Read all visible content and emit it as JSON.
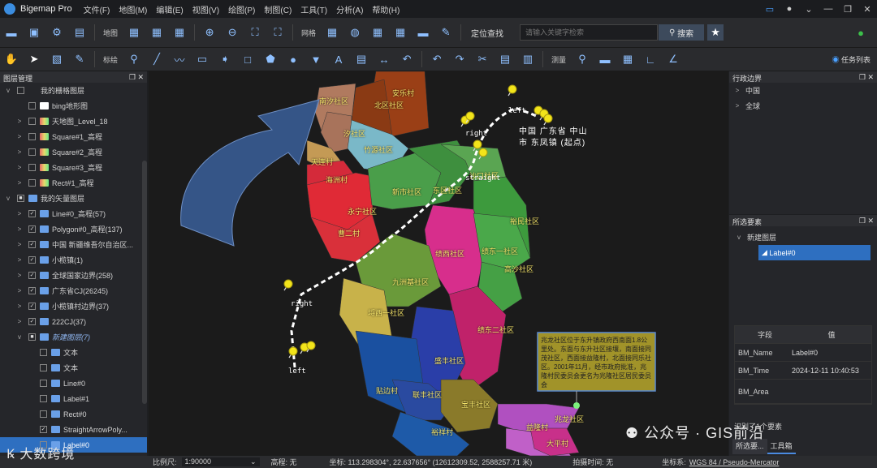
{
  "app": {
    "title": "Bigemap Pro"
  },
  "menu": [
    "文件(F)",
    "地图(M)",
    "编辑(E)",
    "视图(V)",
    "绘图(P)",
    "制图(C)",
    "工具(T)",
    "分析(A)",
    "帮助(H)"
  ],
  "toolbar1": {
    "map_label": "地图",
    "grid_label": "网格",
    "locate_label": "定位查找",
    "search_placeholder": "请输入关键字检索",
    "search_button": "搜索"
  },
  "toolbar2": {
    "annotate_label": "标绘",
    "measure_label": "测量",
    "task_list": "任务列表"
  },
  "layer_panel": {
    "title": "图层管理",
    "items": [
      {
        "level": 0,
        "label": "我的栅格图层",
        "expand": "v",
        "check": ""
      },
      {
        "level": 1,
        "label": "bing地形图",
        "expand": "",
        "check": ""
      },
      {
        "level": 1,
        "label": "天地图_Level_18",
        "expand": ">",
        "check": ""
      },
      {
        "level": 1,
        "label": "Square#1_高程",
        "expand": ">",
        "check": ""
      },
      {
        "level": 1,
        "label": "Square#2_高程",
        "expand": ">",
        "check": ""
      },
      {
        "level": 1,
        "label": "Square#3_高程",
        "expand": ">",
        "check": ""
      },
      {
        "level": 1,
        "label": "Rect#1_高程",
        "expand": ">",
        "check": ""
      },
      {
        "level": 0,
        "label": "我的矢量图层",
        "expand": "v",
        "check": "■"
      },
      {
        "level": 1,
        "label": "Line#0_高程(57)",
        "expand": ">",
        "check": "✓"
      },
      {
        "level": 1,
        "label": "Polygon#0_高程(137)",
        "expand": ">",
        "check": "✓"
      },
      {
        "level": 1,
        "label": "中国 新疆维吾尔自治区...",
        "expand": ">",
        "check": "✓"
      },
      {
        "level": 1,
        "label": "小榄镇(1)",
        "expand": ">",
        "check": "✓"
      },
      {
        "level": 1,
        "label": "全球国家边界(258)",
        "expand": ">",
        "check": "✓"
      },
      {
        "level": 1,
        "label": "广东省CJ(26245)",
        "expand": ">",
        "check": "✓"
      },
      {
        "level": 1,
        "label": "小榄镇村边界(37)",
        "expand": ">",
        "check": "✓"
      },
      {
        "level": 1,
        "label": "222CJ(37)",
        "expand": ">",
        "check": "✓"
      },
      {
        "level": 1,
        "label": "新建图层(7)",
        "expand": "v",
        "check": "■",
        "italic": true
      },
      {
        "level": 2,
        "label": "文本",
        "expand": "",
        "check": ""
      },
      {
        "level": 2,
        "label": "文本",
        "expand": "",
        "check": ""
      },
      {
        "level": 2,
        "label": "Line#0",
        "expand": "",
        "check": ""
      },
      {
        "level": 2,
        "label": "Label#1",
        "expand": "",
        "check": ""
      },
      {
        "level": 2,
        "label": "Rect#0",
        "expand": "",
        "check": ""
      },
      {
        "level": 2,
        "label": "StraightArrowPoly...",
        "expand": "",
        "check": "✓"
      },
      {
        "level": 2,
        "label": "Label#0",
        "expand": "",
        "check": "",
        "selected": true
      }
    ]
  },
  "admin_panel": {
    "title": "行政边界",
    "items": [
      "中国",
      "全球"
    ]
  },
  "selection_panel": {
    "title": "所选要素",
    "layer": "新建图层",
    "element": "Label#0",
    "table_headers": [
      "字段",
      "值"
    ],
    "rows": [
      {
        "k": "BM_Name",
        "v": "Label#0"
      },
      {
        "k": "BM_Time",
        "v": "2024-12-11 10:40:53"
      },
      {
        "k": "BM_Area",
        "v": ""
      }
    ],
    "status": "识别了1个要素",
    "tabs": [
      "所选要...",
      "工具箱"
    ]
  },
  "map": {
    "regions": [
      {
        "label": "安乐村",
        "color": "#9a3f16"
      },
      {
        "label": "北区社区",
        "color": "#8a3a14"
      },
      {
        "label": "南汐社区",
        "color": "#b07a5f"
      },
      {
        "label": "汐社区",
        "color": "#a8735b"
      },
      {
        "label": "竹源社区",
        "color": "#7ab8c8"
      },
      {
        "label": "天连村",
        "color": "#c49a55"
      },
      {
        "label": "海洲村",
        "color": "#d42a3a"
      },
      {
        "label": "永宁社区",
        "color": "#e02a36"
      },
      {
        "label": "曹二村",
        "color": "#d9303a"
      },
      {
        "label": "新市社区",
        "color": "#4a9e4a"
      },
      {
        "label": "东区社区",
        "color": "#3e8f3e"
      },
      {
        "label": "沙口社区",
        "color": "#5aa552"
      },
      {
        "label": "裕民社区",
        "color": "#3d9a3d"
      },
      {
        "label": "绩西社区",
        "color": "#d72e8c"
      },
      {
        "label": "绩东一社区",
        "color": "#4aa84a"
      },
      {
        "label": "高沙社区",
        "color": "#45a045"
      },
      {
        "label": "九洲基社区",
        "color": "#6a9a3a"
      },
      {
        "label": "埒西一社区",
        "color": "#c8b24a"
      },
      {
        "label": "绩东二社区",
        "color": "#c0226a"
      },
      {
        "label": "盛丰社区",
        "color": "#2a3ea8"
      },
      {
        "label": "贴边村",
        "color": "#1a50a0"
      },
      {
        "label": "联丰社区",
        "color": "#2a4aa0"
      },
      {
        "label": "宝丰社区",
        "color": "#8a7a2a"
      },
      {
        "label": "裕祥村",
        "color": "#1e5aa8"
      },
      {
        "label": "兆龙社区",
        "color": "#b050c0"
      },
      {
        "label": "益隆村",
        "color": "#c060c8"
      },
      {
        "label": "大平村",
        "color": "#c8308a"
      }
    ],
    "route_labels": [
      "right",
      "left",
      "straight",
      "right",
      "left"
    ],
    "start_label": "中国 广东省 中山市 东凤镇 (起点)",
    "callout_text": "兆龙社区位于东升镇政府西南面1.8公里处。东面与东升社区接壤，南面接同茂社区，西面接益隆村，北面接同乐社区。2001年11月，经市政府批准，兆隆村民委员会更名为兆隆社区居民委员会"
  },
  "statusbar": {
    "scale_label": "比例尺:",
    "scale_value": "1:90000",
    "elev_label": "高程: 无",
    "coord_label": "坐标: 113.298304°, 22.637656° (12612309.52, 2588257.71 米)",
    "shoot_label": "拍摄时间: 无",
    "crs_label": "坐标系:",
    "crs_value": "WGS 84 / Pseudo-Mercator"
  },
  "watermarks": {
    "right": "公众号 · GIS前沿",
    "left": "大数跨境"
  }
}
